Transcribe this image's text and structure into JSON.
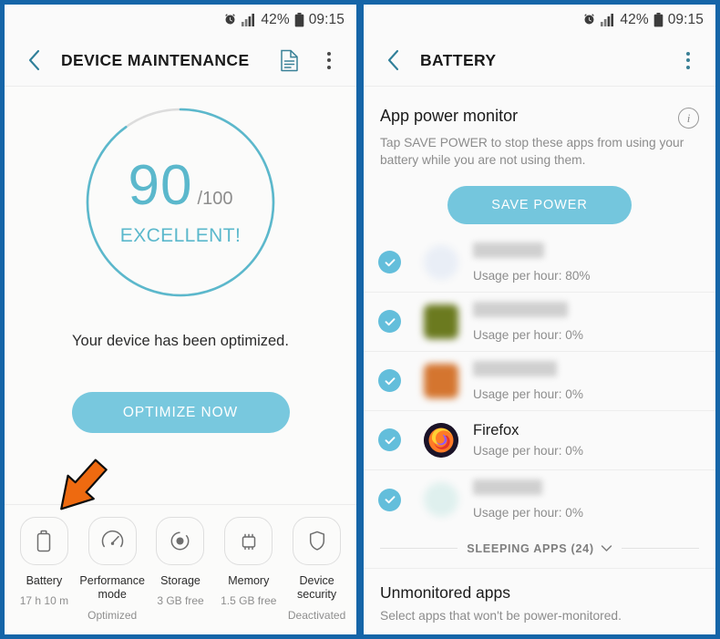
{
  "theme": {
    "frame_blue": "#1565a8",
    "accent_teal": "#5bb8cc",
    "button_blue": "#78c8de",
    "check_blue": "#63bedb",
    "cursor_orange": "#ee6a10"
  },
  "status_bar": {
    "alarm_icon": "alarm-clock-icon",
    "signal_icon": "signal-bars-icon",
    "battery_percent": "42%",
    "battery_icon": "battery-icon",
    "time": "09:15"
  },
  "left_screen": {
    "appbar": {
      "back_icon": "back-chevron-icon",
      "title": "DEVICE MAINTENANCE",
      "document_icon": "document-icon",
      "overflow_icon": "three-dot-menu-icon"
    },
    "gauge": {
      "score": "90",
      "max": "/100",
      "rating": "EXCELLENT!",
      "percent": 90
    },
    "status_message": "Your device has been optimized.",
    "optimize_button": "OPTIMIZE NOW",
    "tiles": [
      {
        "icon": "battery-icon",
        "label": "Battery",
        "sub": "17 h 10 m"
      },
      {
        "icon": "speedometer-icon",
        "label": "Performance mode",
        "sub": "Optimized"
      },
      {
        "icon": "storage-disc-icon",
        "label": "Storage",
        "sub": "3 GB free"
      },
      {
        "icon": "memory-chip-icon",
        "label": "Memory",
        "sub": "1.5 GB free"
      },
      {
        "icon": "shield-icon",
        "label": "Device security",
        "sub": "Deactivated"
      }
    ]
  },
  "right_screen": {
    "appbar": {
      "back_icon": "back-chevron-icon",
      "title": "BATTERY",
      "overflow_icon": "three-dot-menu-icon"
    },
    "section": {
      "title": "App power monitor",
      "info_icon": "info-icon",
      "description": "Tap SAVE POWER to stop these apps from using your battery while you are not using them."
    },
    "save_power_button": "SAVE POWER",
    "apps": [
      {
        "name": "",
        "redacted": true,
        "usage": "Usage per hour: 80%",
        "icon_color": "#e9eef6",
        "round": true,
        "checked": true
      },
      {
        "name": "",
        "redacted": true,
        "usage": "Usage per hour: 0%",
        "icon_color": "#6b7a1f",
        "round": false,
        "checked": true
      },
      {
        "name": "",
        "redacted": true,
        "usage": "Usage per hour: 0%",
        "icon_color": "#d4752f",
        "round": false,
        "checked": true
      },
      {
        "name": "Firefox",
        "redacted": false,
        "usage": "Usage per hour: 0%",
        "icon_color": "#1c1427",
        "round": true,
        "checked": true
      },
      {
        "name": "",
        "redacted": true,
        "usage": "Usage per hour: 0%",
        "icon_color": "#dff0ee",
        "round": true,
        "checked": true
      }
    ],
    "sleeping_apps": {
      "label": "SLEEPING APPS (24)",
      "chevron_icon": "chevron-down-icon"
    },
    "unmonitored": {
      "title": "Unmonitored apps",
      "description": "Select apps that won't be power-monitored."
    }
  }
}
